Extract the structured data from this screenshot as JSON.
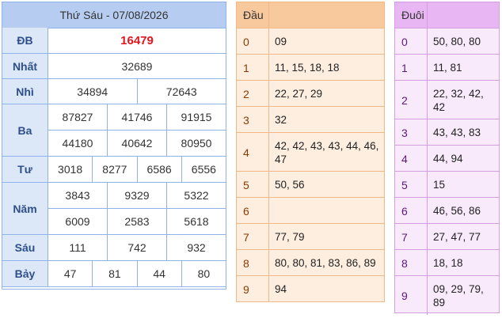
{
  "results": {
    "title": "Thứ Sáu - 07/08/2026",
    "rows": [
      {
        "label": "ĐB",
        "lines": [
          [
            "16479"
          ]
        ]
      },
      {
        "label": "Nhất",
        "lines": [
          [
            "32689"
          ]
        ]
      },
      {
        "label": "Nhì",
        "lines": [
          [
            "34894",
            "72643"
          ]
        ]
      },
      {
        "label": "Ba",
        "lines": [
          [
            "87827",
            "41746",
            "91915"
          ],
          [
            "44180",
            "40642",
            "80950"
          ]
        ]
      },
      {
        "label": "Tư",
        "lines": [
          [
            "3018",
            "8277",
            "6586",
            "6556"
          ]
        ]
      },
      {
        "label": "Năm",
        "lines": [
          [
            "3843",
            "9329",
            "5322"
          ],
          [
            "6009",
            "2583",
            "5618"
          ]
        ]
      },
      {
        "label": "Sáu",
        "lines": [
          [
            "111",
            "742",
            "932"
          ]
        ]
      },
      {
        "label": "Bảy",
        "lines": [
          [
            "47",
            "81",
            "44",
            "80"
          ]
        ]
      }
    ]
  },
  "dau": {
    "header": "Đầu",
    "rows": [
      {
        "key": "0",
        "value": "09"
      },
      {
        "key": "1",
        "value": "11, 15, 18, 18"
      },
      {
        "key": "2",
        "value": "22, 27, 29"
      },
      {
        "key": "3",
        "value": "32"
      },
      {
        "key": "4",
        "value": "42, 42, 43, 43, 44, 46, 47"
      },
      {
        "key": "5",
        "value": "50, 56"
      },
      {
        "key": "6",
        "value": ""
      },
      {
        "key": "7",
        "value": "77, 79"
      },
      {
        "key": "8",
        "value": "80, 80, 81, 83, 86, 89"
      },
      {
        "key": "9",
        "value": "94"
      }
    ]
  },
  "duoi": {
    "header": "Đuôi",
    "rows": [
      {
        "key": "0",
        "value": "50, 80, 80"
      },
      {
        "key": "1",
        "value": "11, 81"
      },
      {
        "key": "2",
        "value": "22, 32, 42, 42"
      },
      {
        "key": "3",
        "value": "43, 43, 83"
      },
      {
        "key": "4",
        "value": "44, 94"
      },
      {
        "key": "5",
        "value": "15"
      },
      {
        "key": "6",
        "value": "46, 56, 86"
      },
      {
        "key": "7",
        "value": "27, 47, 77"
      },
      {
        "key": "8",
        "value": "18, 18"
      },
      {
        "key": "9",
        "value": "09, 29, 79, 89"
      }
    ]
  },
  "colors": {
    "special_prize": "#e0151d",
    "results_header": "#b6cdf1",
    "dau_header": "#f9c99e",
    "duoi_header": "#e8b6f2"
  }
}
